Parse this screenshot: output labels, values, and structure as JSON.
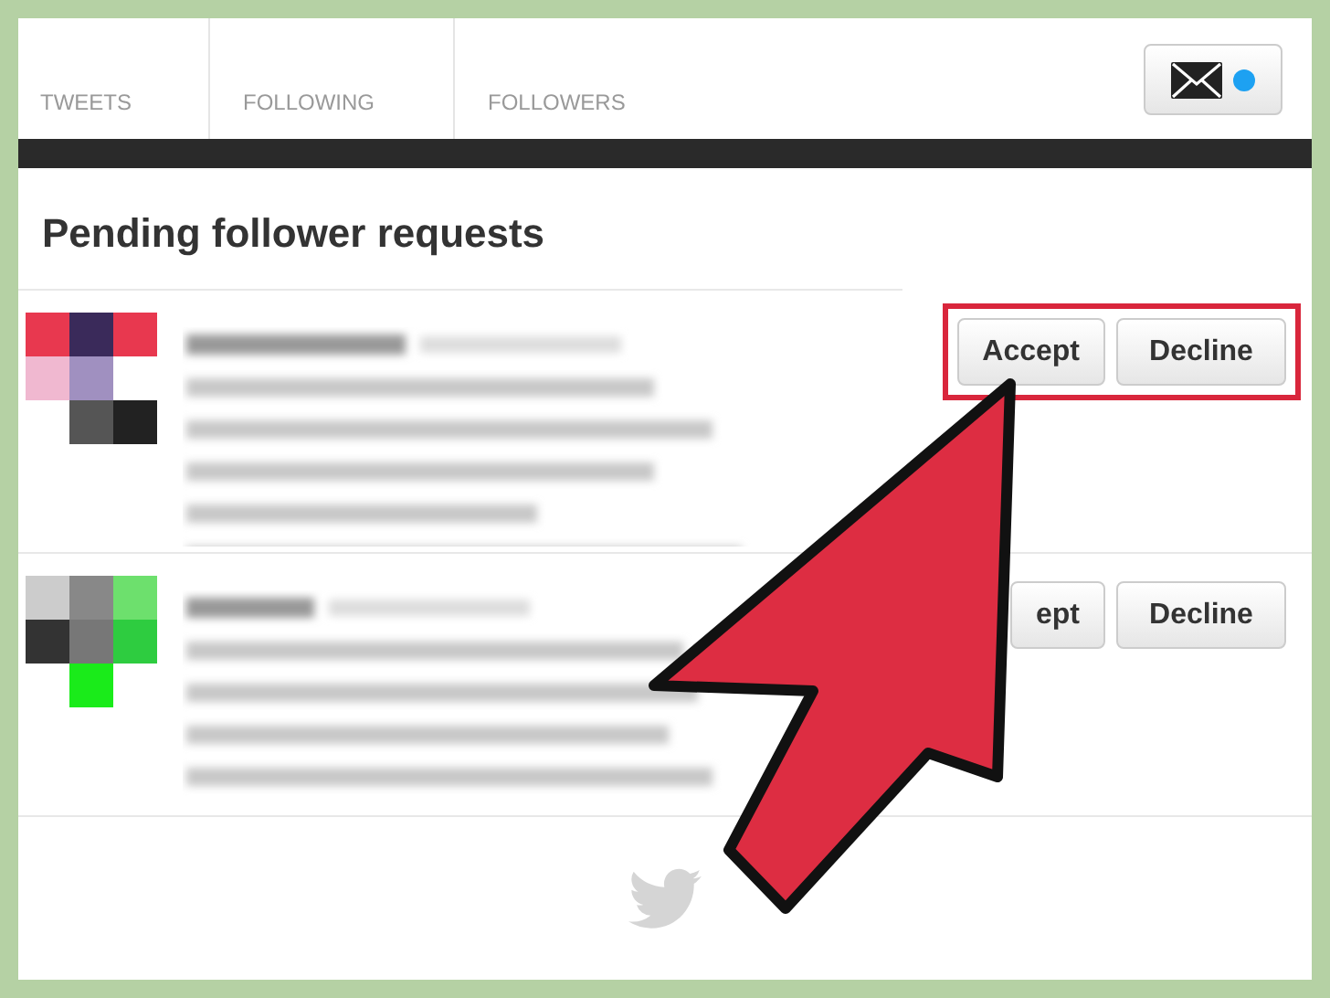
{
  "tabs": [
    {
      "label": "TWEETS"
    },
    {
      "label": "FOLLOWING"
    },
    {
      "label": "FOLLOWERS"
    }
  ],
  "messages": {
    "unread": true
  },
  "title": "Pending follower requests",
  "requests": [
    {
      "accept": "Accept",
      "decline": "Decline",
      "highlighted": true
    },
    {
      "accept": "ept",
      "decline": "Decline",
      "highlighted": false
    }
  ]
}
